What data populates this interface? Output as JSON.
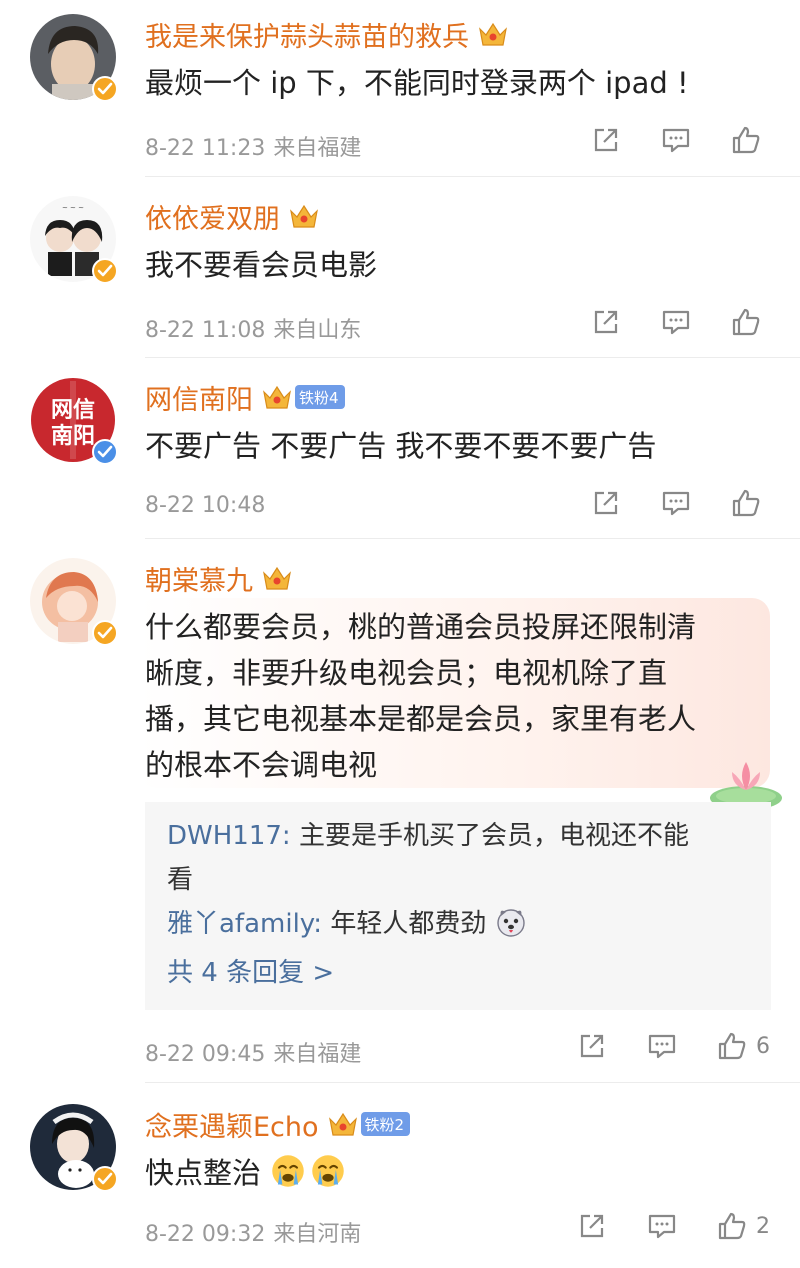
{
  "comments": [
    {
      "username": "我是来保护蒜头蒜苗的救兵",
      "text": "最烦一个 ip 下，不能同时登录两个 ipad !",
      "time": "8-22 11:23",
      "source": "来自福建",
      "likes": ""
    },
    {
      "username": "依依爱双朋",
      "text": "我不要看会员电影",
      "time": "8-22 11:08",
      "source": "来自山东",
      "likes": ""
    },
    {
      "username": "网信南阳",
      "fan_badge": "铁粉4",
      "avatar_text": "网信南阳",
      "text": "不要广告 不要广告 我不要不要不要广告",
      "time": "8-22 10:48",
      "source": "",
      "likes": ""
    },
    {
      "username": "朝棠慕九",
      "text_lines": [
        "什么都要会员，桃的普通会员投屏还限制清",
        "晰度，非要升级电视会员；电视机除了直",
        "播，其它电视基本是都是会员，家里有老人",
        "的根本不会调电视"
      ],
      "replies": [
        {
          "name": "DWH117",
          "sep": ": ",
          "text_lines": [
            "主要是手机买了会员，电视还不能",
            "看"
          ]
        },
        {
          "name": "雅丫afamily",
          "sep": ": ",
          "text_lines": [
            "年轻人都费劲"
          ]
        }
      ],
      "more_replies": "共 4 条回复 >",
      "time": "8-22 09:45",
      "source": "来自福建",
      "likes": "6"
    },
    {
      "username": "念栗遇颖Echo",
      "fan_badge": "铁粉2",
      "text": "快点整治",
      "time": "8-22 09:32",
      "source": "来自河南",
      "likes": "2"
    }
  ],
  "icons": {
    "share": "share-icon",
    "comment": "comment-icon",
    "like": "like-icon",
    "verified": "verified-badge-icon",
    "crown": "crown-icon",
    "emoji_cry": "crying-face-emoji",
    "emoji_dog": "dog-face-emoji",
    "lotus": "lotus-icon"
  },
  "colors": {
    "username": "#e0701f",
    "reply_name": "#4a6f9d",
    "meta": "#999999",
    "verified": "#f5a623",
    "fan_badge": "#6f9ce8",
    "avatar_red": "#c8282e"
  }
}
